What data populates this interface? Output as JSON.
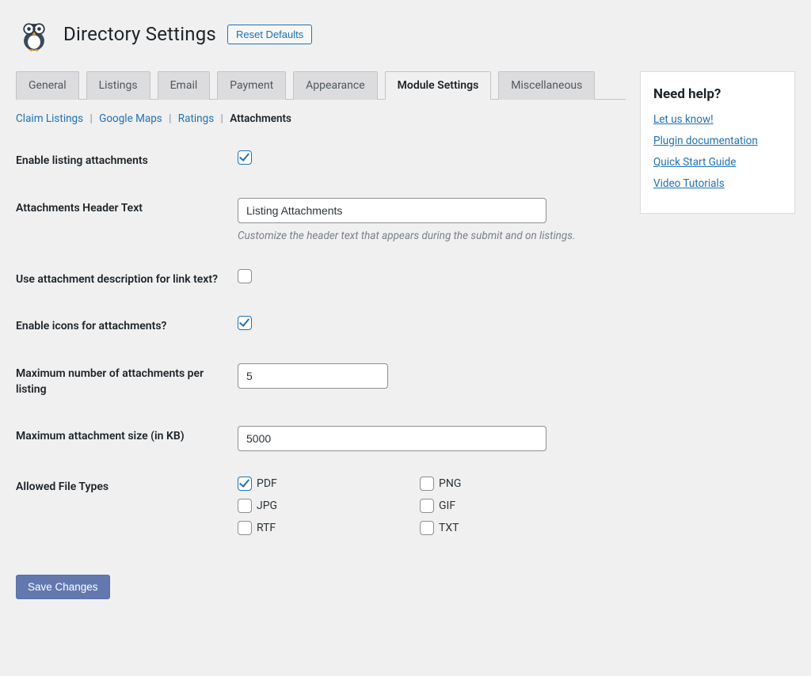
{
  "header": {
    "title": "Directory Settings",
    "reset_label": "Reset Defaults"
  },
  "tabs": [
    {
      "label": "General",
      "active": false
    },
    {
      "label": "Listings",
      "active": false
    },
    {
      "label": "Email",
      "active": false
    },
    {
      "label": "Payment",
      "active": false
    },
    {
      "label": "Appearance",
      "active": false
    },
    {
      "label": "Module Settings",
      "active": true
    },
    {
      "label": "Miscellaneous",
      "active": false
    }
  ],
  "subtabs": {
    "items": [
      {
        "label": "Claim Listings",
        "current": false
      },
      {
        "label": "Google Maps",
        "current": false
      },
      {
        "label": "Ratings",
        "current": false
      },
      {
        "label": "Attachments",
        "current": true
      }
    ],
    "separator": "|"
  },
  "fields": {
    "enable_listing_attachments": {
      "label": "Enable listing attachments",
      "checked": true
    },
    "attachments_header_text": {
      "label": "Attachments Header Text",
      "value": "Listing Attachments",
      "description": "Customize the header text that appears during the submit and on listings."
    },
    "use_description_link_text": {
      "label": "Use attachment description for link text?",
      "checked": false
    },
    "enable_icons": {
      "label": "Enable icons for attachments?",
      "checked": true
    },
    "max_number": {
      "label": "Maximum number of attachments per listing",
      "value": "5"
    },
    "max_size_kb": {
      "label": "Maximum attachment size (in KB)",
      "value": "5000"
    },
    "allowed_file_types": {
      "label": "Allowed File Types",
      "options": [
        {
          "label": "PDF",
          "checked": true
        },
        {
          "label": "PNG",
          "checked": false
        },
        {
          "label": "JPG",
          "checked": false
        },
        {
          "label": "GIF",
          "checked": false
        },
        {
          "label": "RTF",
          "checked": false
        },
        {
          "label": "TXT",
          "checked": false
        }
      ]
    }
  },
  "buttons": {
    "save": "Save Changes"
  },
  "sidebar": {
    "help_title": "Need help?",
    "links": [
      "Let us know!",
      "Plugin documentation",
      "Quick Start Guide",
      "Video Tutorials"
    ]
  }
}
